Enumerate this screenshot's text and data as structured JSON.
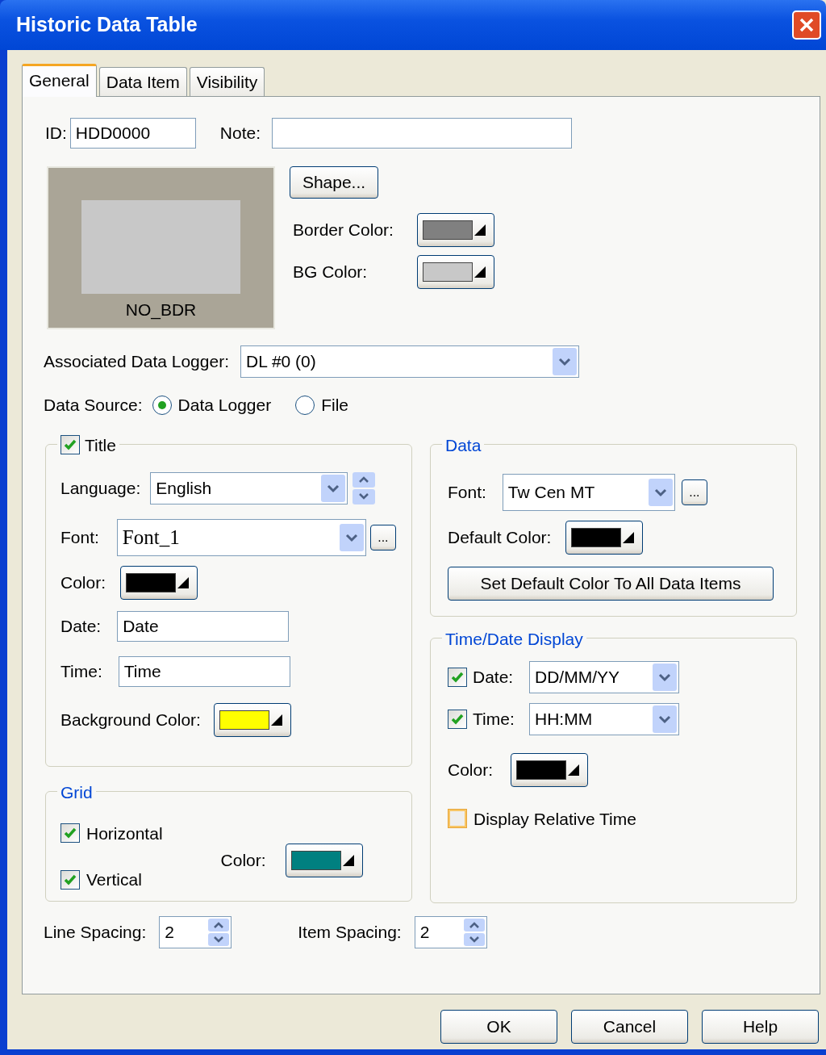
{
  "window": {
    "title": "Historic Data Table"
  },
  "tabs": [
    {
      "label": "General",
      "selected": true
    },
    {
      "label": "Data Item",
      "selected": false
    },
    {
      "label": "Visibility",
      "selected": false
    }
  ],
  "id_field": {
    "label": "ID:",
    "value": "HDD0000"
  },
  "note_field": {
    "label": "Note:"
  },
  "preview": {
    "caption": "NO_BDR"
  },
  "shape_button": "Shape...",
  "border_color": {
    "label": "Border Color:",
    "color": "#808080"
  },
  "bg_color": {
    "label": "BG Color:",
    "color": "#c8c8c8"
  },
  "data_logger": {
    "label": "Associated Data Logger:",
    "value": "DL #0 (0)"
  },
  "data_source": {
    "label": "Data Source:",
    "options": [
      {
        "label": "Data Logger",
        "selected": true
      },
      {
        "label": "File",
        "selected": false
      }
    ]
  },
  "title_group": {
    "label": "Title",
    "checked": true,
    "language": {
      "label": "Language:",
      "value": "English"
    },
    "font": {
      "label": "Font:",
      "value": "Font_1",
      "button": "..."
    },
    "color": {
      "label": "Color:",
      "color": "#000000"
    },
    "date": {
      "label": "Date:",
      "value": "Date"
    },
    "time": {
      "label": "Time:",
      "value": "Time"
    },
    "background_color": {
      "label": "Background Color:",
      "color": "#ffff00"
    }
  },
  "grid": {
    "label": "Grid",
    "options": [
      {
        "label": "Horizontal",
        "checked": true
      },
      {
        "label": "Vertical",
        "checked": true
      }
    ],
    "color": {
      "label": "Color:",
      "color": "#008080"
    }
  },
  "data": {
    "label": "Data",
    "font": {
      "label": "Font:",
      "value": "Tw Cen MT",
      "button": "..."
    },
    "default_color": {
      "label": "Default Color:",
      "color": "#000000"
    },
    "button": "Set Default Color To All Data Items"
  },
  "time_date": {
    "label": "Time/Date Display",
    "rows": [
      {
        "label": "Date:",
        "checked": true,
        "value": "DD/MM/YY"
      },
      {
        "label": "Time:",
        "checked": true,
        "value": "HH:MM"
      }
    ],
    "color": {
      "label": "Color:",
      "color": "#000000"
    },
    "relative": {
      "label": "Display Relative Time",
      "checked": false
    }
  },
  "line_spacing": {
    "label": "Line Spacing:",
    "value": "2"
  },
  "item_spacing": {
    "label": "Item Spacing:",
    "value": "2"
  },
  "buttons": [
    "OK",
    "Cancel",
    "Help"
  ]
}
